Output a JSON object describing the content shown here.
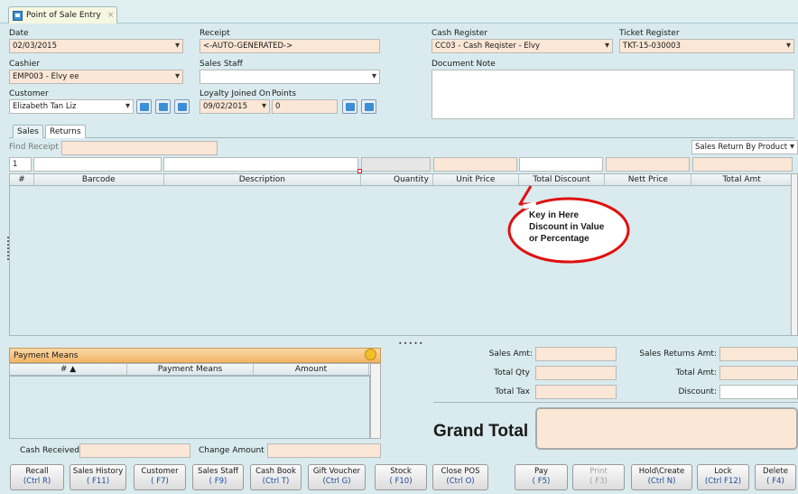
{
  "window": {
    "tab_title": "Point of Sale Entry",
    "tab_close": "×"
  },
  "header": {
    "date": {
      "label": "Date",
      "value": "02/03/2015"
    },
    "receipt": {
      "label": "Receipt",
      "value": "<-AUTO-GENERATED->"
    },
    "cash_register": {
      "label": "Cash Register",
      "value": "CC03 - Cash Reqister - Elvy"
    },
    "ticket_register": {
      "label": "Ticket Register",
      "value": "TKT-15-030003"
    },
    "cashier": {
      "label": "Cashier",
      "value": "EMP003 - Elvy ee"
    },
    "sales_staff": {
      "label": "Sales Staff",
      "value": ""
    },
    "document_note": {
      "label": "Document Note",
      "value": ""
    },
    "customer": {
      "label": "Customer",
      "value": "Elizabeth Tan Liz"
    },
    "loyalty_joined_on": {
      "label": "Loyalty Joined On",
      "value": "09/02/2015"
    },
    "points": {
      "label": "Points",
      "value": "0"
    }
  },
  "subtabs": {
    "sales": "Sales",
    "returns": "Returns"
  },
  "find_receipt": {
    "label": "Find Receipt",
    "value": ""
  },
  "return_mode": {
    "value": "Sales Return By Product"
  },
  "filter_row": {
    "row_number": "1"
  },
  "grid": {
    "columns": [
      "#",
      "Barcode",
      "Description",
      "Quantity",
      "Unit Price",
      "Total Discount",
      "Nett Price",
      "Total Amt"
    ]
  },
  "annotation": {
    "line1": "Key in Here",
    "line2": "Discount in Value",
    "line3": "or Percentage"
  },
  "payment": {
    "title": "Payment Means",
    "columns": [
      "# ▲",
      "Payment Means",
      "Amount"
    ],
    "cash_received_label": "Cash Received",
    "change_amount_label": "Change Amount"
  },
  "totals": {
    "sales_amt": "Sales Amt:",
    "total_qty": "Total Qty",
    "total_tax": "Total Tax",
    "sales_returns_amt": "Sales Returns Amt:",
    "total_amt": "Total Amt:",
    "discount": "Discount:",
    "grand_total": "Grand Total",
    "splitter": "•••••"
  },
  "buttons": [
    {
      "label": "Recall",
      "key": "(Ctrl R)"
    },
    {
      "label": "Sales History",
      "key": "( F11)"
    },
    {
      "label": "Customer",
      "key": "( F7)"
    },
    {
      "label": "Sales Staff",
      "key": "( F9)"
    },
    {
      "label": "Cash Book",
      "key": "(Ctrl T)"
    },
    {
      "label": "Gift Voucher",
      "key": "(Ctrl G)"
    },
    {
      "label": "Stock",
      "key": "( F10)"
    },
    {
      "label": "Close POS",
      "key": "(Ctrl O)"
    },
    {
      "label": "Pay",
      "key": "( F5)"
    },
    {
      "label": "Print",
      "key": "( F3)"
    },
    {
      "label": "Hold\\Create",
      "key": "(Ctrl N)"
    },
    {
      "label": "Lock",
      "key": "(Ctrl F12)"
    },
    {
      "label": "Delete",
      "key": "( F4)"
    }
  ],
  "colors": {
    "accent_orange": "#f6c27d",
    "field_peach": "#fbe7d6",
    "annotation_red": "#e01010"
  }
}
